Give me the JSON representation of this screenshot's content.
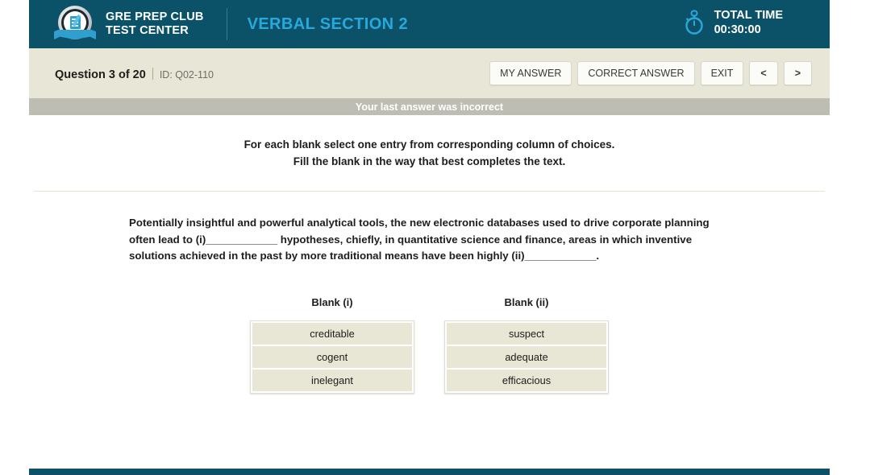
{
  "header": {
    "logo_icon": "gre-prep-club-badge-icon",
    "brand_line1": "GRE PREP CLUB",
    "brand_line2": "TEST CENTER",
    "section_title": "VERBAL SECTION 2",
    "timer_icon": "stopwatch-icon",
    "timer_label": "TOTAL TIME",
    "timer_value": "00:30:00",
    "colors": {
      "background": "#0b5269",
      "section_title": "#29a8dd",
      "timer_icon": "#29a8dd"
    }
  },
  "question_bar": {
    "question_counter": "Question 3 of 20",
    "question_id": "ID: Q02-110",
    "buttons": [
      {
        "label": "MY ANSWER",
        "name": "my-answer-button"
      },
      {
        "label": "CORRECT ANSWER",
        "name": "correct-answer-button"
      },
      {
        "label": "EXIT",
        "name": "exit-button"
      },
      {
        "label": "<",
        "name": "previous-question-button"
      },
      {
        "label": ">",
        "name": "next-question-button"
      }
    ],
    "background": "#e8e6d7"
  },
  "status": {
    "message": "Your last answer was incorrect",
    "background": "#bdbdb4",
    "text_color": "#ffffff"
  },
  "instructions": {
    "line1": "For each blank select one entry from corresponding column of choices.",
    "line2": "Fill the blank in the way that best completes the text."
  },
  "passage": {
    "text": "Potentially insightful and powerful analytical tools, the new electronic databases used to drive corporate planning often lead to (i)____________ hypotheses, chiefly, in quantitative science and finance, areas in which inventive solutions achieved in the past by more traditional means have been highly (ii)____________."
  },
  "blanks": [
    {
      "label": "Blank (i)",
      "choices": [
        "creditable",
        "cogent",
        "inelegant"
      ]
    },
    {
      "label": "Blank (ii)",
      "choices": [
        "suspect",
        "adequate",
        "efficacious"
      ]
    }
  ],
  "choice_colors": {
    "fill": "#e8e6d5",
    "text": "#1d1d1b"
  }
}
